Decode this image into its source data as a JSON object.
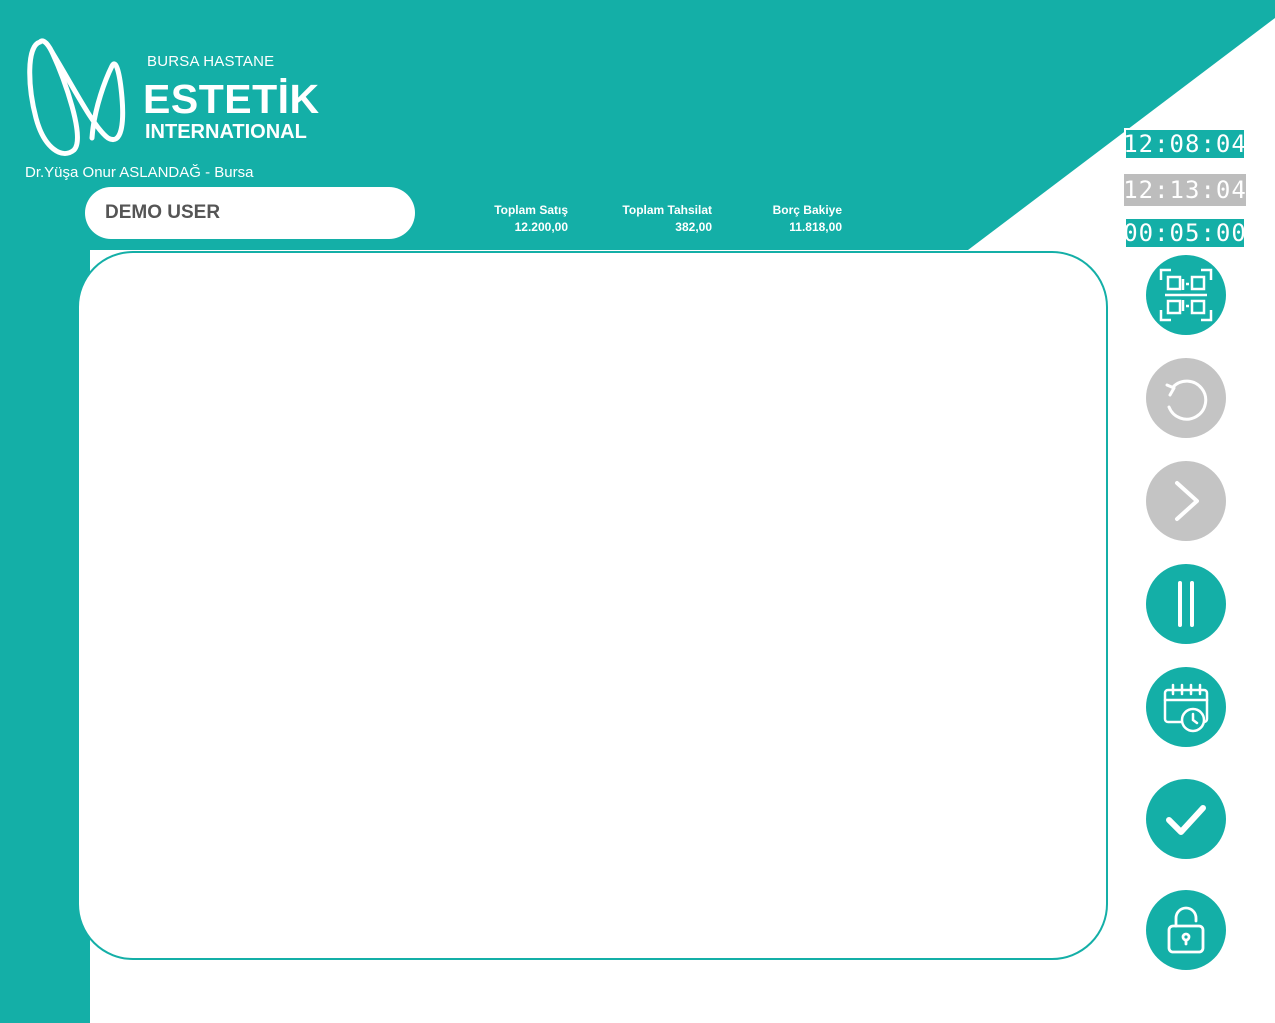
{
  "brand": {
    "top_text": "BURSA HASTANE",
    "main_text": "ESTETİK",
    "sub_text": "INTERNATIONAL",
    "logo_icon": "brand-logo-mark"
  },
  "doctor_line": "Dr.Yüşa Onur ASLANDAĞ - Bursa",
  "user_name": "DEMO USER",
  "stats": [
    {
      "label": "Toplam Satış",
      "value": "12.200,00"
    },
    {
      "label": "Toplam Tahsilat",
      "value": "382,00"
    },
    {
      "label": "Borç Bakiye",
      "value": "11.818,00"
    }
  ],
  "clocks": {
    "clock1": "12:08:04",
    "clock2": "12:13:04",
    "clock3": "00:05:00"
  },
  "side_buttons": [
    {
      "icon": "qr-scan-icon",
      "state": "active"
    },
    {
      "icon": "undo-icon",
      "state": "disabled"
    },
    {
      "icon": "chevron-right-icon",
      "state": "disabled"
    },
    {
      "icon": "pause-icon",
      "state": "active"
    },
    {
      "icon": "calendar-clock-icon",
      "state": "active"
    },
    {
      "icon": "checkmark-icon",
      "state": "active"
    },
    {
      "icon": "unlock-icon",
      "state": "active"
    }
  ],
  "colors": {
    "accent": "#14AFA7",
    "disabled": "#C4C4C4",
    "panel": "#FFFFFF",
    "user_text": "#555555"
  }
}
